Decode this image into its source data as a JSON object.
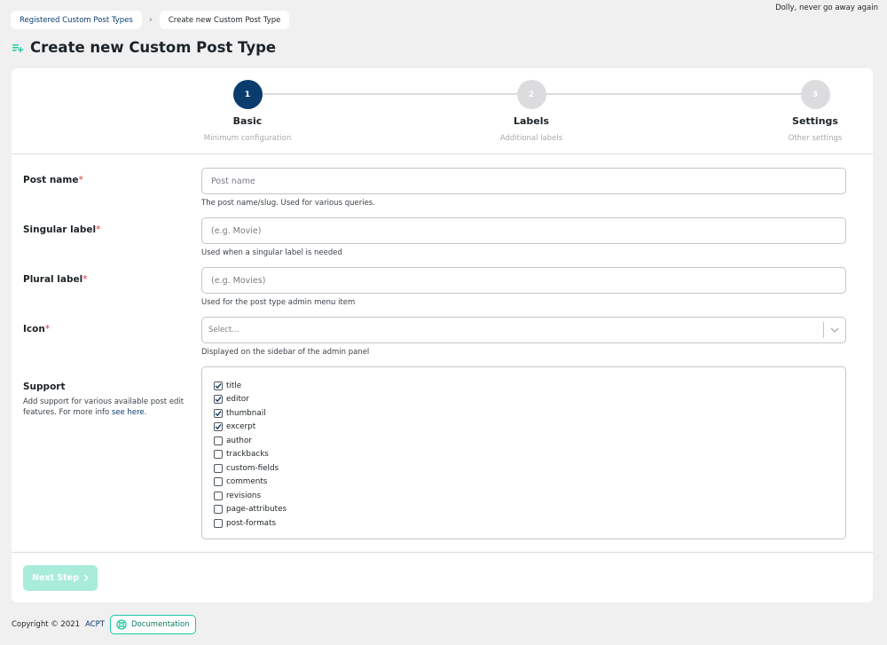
{
  "notice": "Dolly, never go away again",
  "breadcrumb": {
    "link": "Registered Custom Post Types",
    "current": "Create new Custom Post Type"
  },
  "page_title": "Create new Custom Post Type",
  "steps": [
    {
      "number": "1",
      "title": "Basic",
      "subtitle": "Minimum configuration",
      "active": true
    },
    {
      "number": "2",
      "title": "Labels",
      "subtitle": "Additional labels",
      "active": false
    },
    {
      "number": "3",
      "title": "Settings",
      "subtitle": "Other settings",
      "active": false
    }
  ],
  "fields": {
    "post_name": {
      "label": "Post name",
      "placeholder": "Post name",
      "help": "The post name/slug. Used for various queries."
    },
    "singular_label": {
      "label": "Singular label",
      "placeholder": "(e.g. Movie)",
      "help": "Used when a singular label is needed"
    },
    "plural_label": {
      "label": "Plural label",
      "placeholder": "(e.g. Movies)",
      "help": "Used for the post type admin menu item"
    },
    "icon": {
      "label": "Icon",
      "placeholder": "Select...",
      "help": "Displayed on the sidebar of the admin panel"
    }
  },
  "required_mark": "*",
  "support": {
    "title": "Support",
    "description": "Add support for various available post edit features. For more info",
    "link_text": "see here.",
    "options": [
      {
        "label": "title",
        "checked": true
      },
      {
        "label": "editor",
        "checked": true
      },
      {
        "label": "thumbnail",
        "checked": true
      },
      {
        "label": "excerpt",
        "checked": true
      },
      {
        "label": "author",
        "checked": false
      },
      {
        "label": "trackbacks",
        "checked": false
      },
      {
        "label": "custom-fields",
        "checked": false
      },
      {
        "label": "comments",
        "checked": false
      },
      {
        "label": "revisions",
        "checked": false
      },
      {
        "label": "page-attributes",
        "checked": false
      },
      {
        "label": "post-formats",
        "checked": false
      }
    ]
  },
  "next_button": "Next Step",
  "footer": {
    "copyright": "Copyright © 2021",
    "brand": "ACPT",
    "doc_button": "Documentation"
  },
  "colors": {
    "primary": "#0b3c6e",
    "accent": "#19c9a1",
    "next_disabled": "#a8ecd9",
    "required": "#d63638"
  }
}
